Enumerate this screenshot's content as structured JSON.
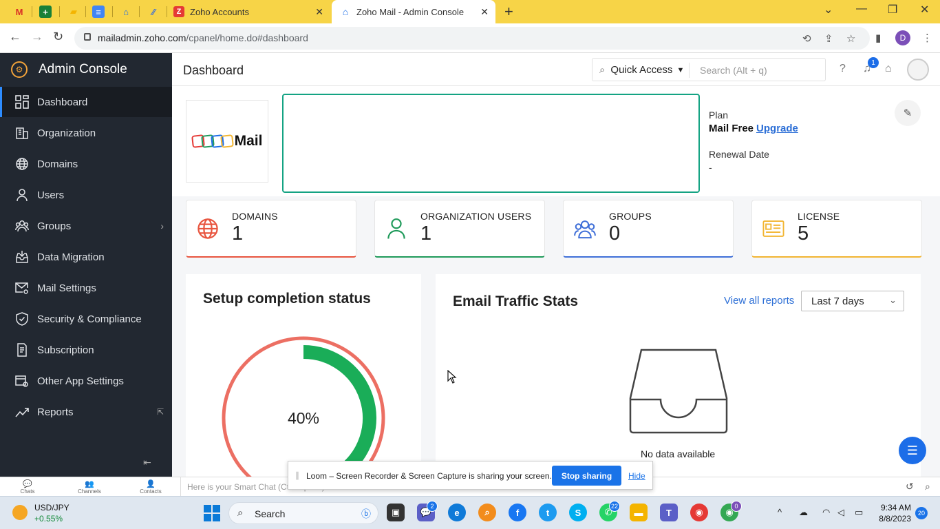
{
  "browser": {
    "tabs": [
      {
        "title": "Zoho Accounts",
        "favicon_color": "#e53935"
      },
      {
        "title": "Zoho Mail - Admin Console",
        "favicon_color": "#1c6de8"
      }
    ],
    "url_host": "mailadmin.zoho.com",
    "url_path": "/cpanel/home.do#dashboard",
    "profile_initial": "D"
  },
  "sidebar": {
    "title": "Admin Console",
    "items": [
      {
        "label": "Dashboard",
        "icon": "dashboard-grid-icon"
      },
      {
        "label": "Organization",
        "icon": "building-icon"
      },
      {
        "label": "Domains",
        "icon": "globe-icon"
      },
      {
        "label": "Users",
        "icon": "user-icon"
      },
      {
        "label": "Groups",
        "icon": "group-icon"
      },
      {
        "label": "Data Migration",
        "icon": "inbox-download-icon"
      },
      {
        "label": "Mail Settings",
        "icon": "mail-gear-icon"
      },
      {
        "label": "Security & Compliance",
        "icon": "shield-icon"
      },
      {
        "label": "Subscription",
        "icon": "receipt-icon"
      },
      {
        "label": "Other App Settings",
        "icon": "app-gear-icon"
      },
      {
        "label": "Reports",
        "icon": "trend-icon"
      }
    ]
  },
  "header": {
    "title": "Dashboard",
    "quick_access": "Quick Access",
    "search_placeholder": "Search (Alt + q)",
    "notification_count": "1"
  },
  "org": {
    "logo_text": "Mail",
    "plan_label": "Plan",
    "plan_value": "Mail Free",
    "upgrade": "Upgrade",
    "renewal_label": "Renewal Date",
    "renewal_value": "-"
  },
  "stats": [
    {
      "label": "DOMAINS",
      "value": "1",
      "color": "#e8553f"
    },
    {
      "label": "ORGANIZATION USERS",
      "value": "1",
      "color": "#1f9a5a"
    },
    {
      "label": "GROUPS",
      "value": "0",
      "color": "#3f6fd8"
    },
    {
      "label": "LICENSE",
      "value": "5",
      "color": "#f2b531"
    }
  ],
  "setup": {
    "title": "Setup completion status",
    "percent_label": "40%",
    "fraction": 0.4
  },
  "traffic": {
    "title": "Email Traffic Stats",
    "view_all": "View all reports",
    "range": "Last 7 days",
    "empty": "No data available"
  },
  "cliq": {
    "items": [
      "Chats",
      "Channels",
      "Contacts"
    ],
    "placeholder": "Here is your Smart Chat (Ctrl+Space)"
  },
  "loom": {
    "message": "Loom – Screen Recorder & Screen Capture is sharing your screen.",
    "stop": "Stop sharing",
    "hide": "Hide"
  },
  "taskbar": {
    "ticker_name": "USD/JPY",
    "ticker_change": "+0.55%",
    "search": "Search",
    "badges": {
      "chat": "2",
      "whatsapp": "22",
      "chrome": "0"
    },
    "time": "9:34 AM",
    "date": "8/8/2023",
    "notifications": "20"
  }
}
